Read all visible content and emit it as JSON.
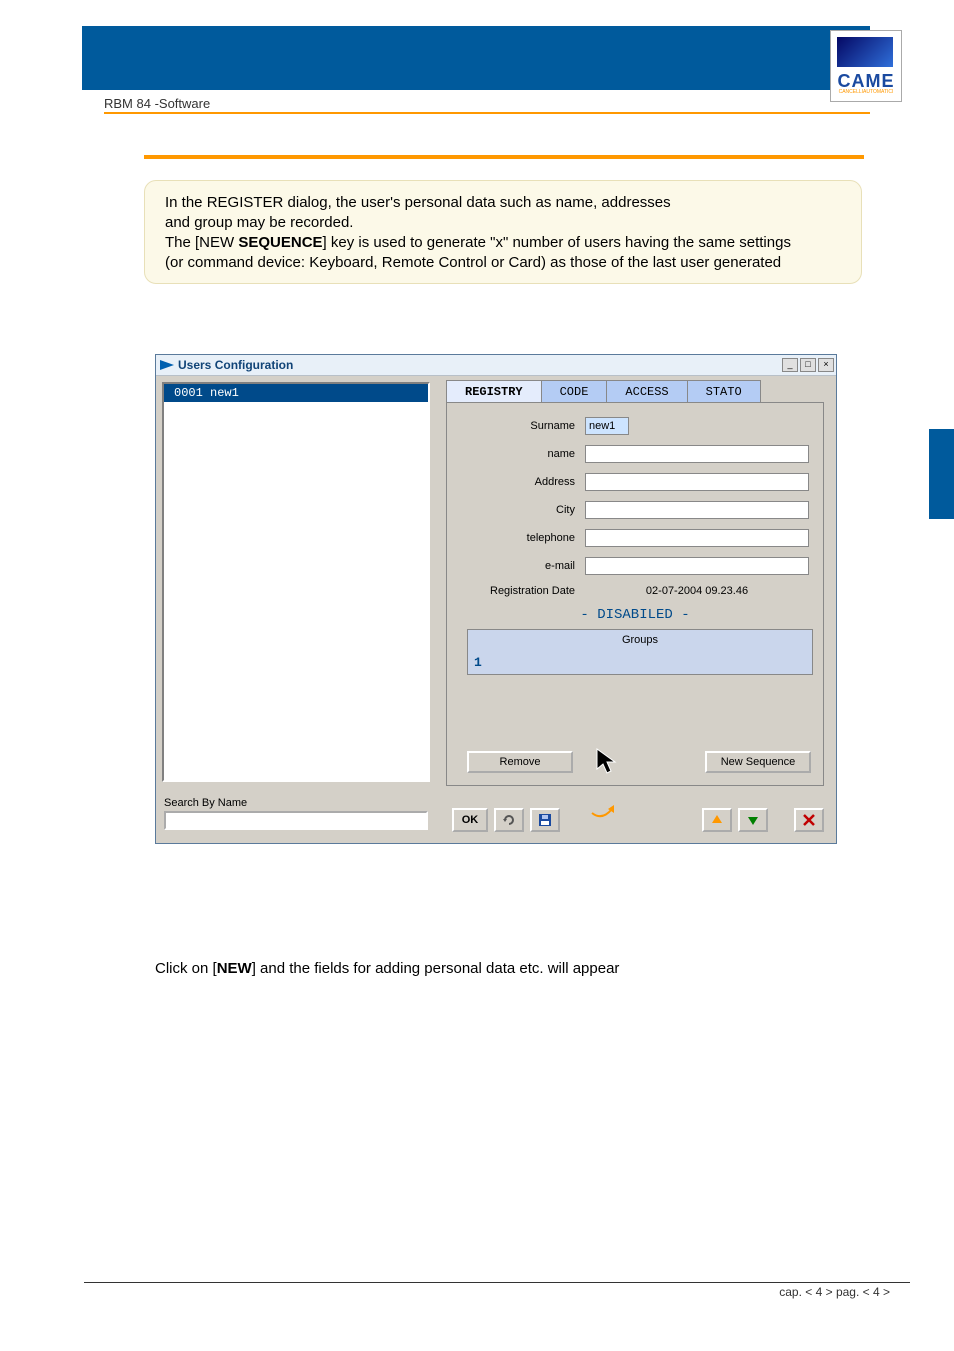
{
  "doc_title": "RBM 84 -Software",
  "logo": {
    "brand": "CAME",
    "sub": "CANCELLIAUTOMATICI"
  },
  "note": {
    "l1_a": "  In the REGISTER dialog, the user's personal data such as name, addresses",
    "l1_b": "and group may be recorded.",
    "l2_a": "The [NEW ",
    "l2_b": "SEQUENCE",
    "l2_c": "] key is used to generate \"x\" number of users having the same settings",
    "l3": "(or command device: Keyboard, Remote Control or Card) as those of the last user generated"
  },
  "window_title": "Users Configuration",
  "selected_item": "0001 new1",
  "tabs": {
    "registry": "REGISTRY",
    "code": "CODE",
    "access": "ACCESS",
    "stato": "STATO"
  },
  "fields": {
    "surname_lbl": "Surname",
    "surname_val": "new1",
    "name_lbl": "name",
    "name_val": "",
    "address_lbl": "Address",
    "address_val": "",
    "city_lbl": "City",
    "city_val": "",
    "telephone_lbl": "telephone",
    "telephone_val": "",
    "email_lbl": "e-mail",
    "email_val": "",
    "regdate_lbl": "Registration Date",
    "regdate_val": "02-07-2004 09.23.46",
    "disabled": "- DISABILED -",
    "groups_head": "Groups",
    "groups_num": "1"
  },
  "buttons": {
    "remove": "Remove",
    "new_sequence": "New Sequence",
    "ok": "OK"
  },
  "search_lbl": "Search By Name",
  "caption_a": "Click on [",
  "caption_b": "NEW",
  "caption_c": "] and the fields for adding personal data etc. will appear",
  "footer": "cap. < 4 > pag. < 4 >"
}
